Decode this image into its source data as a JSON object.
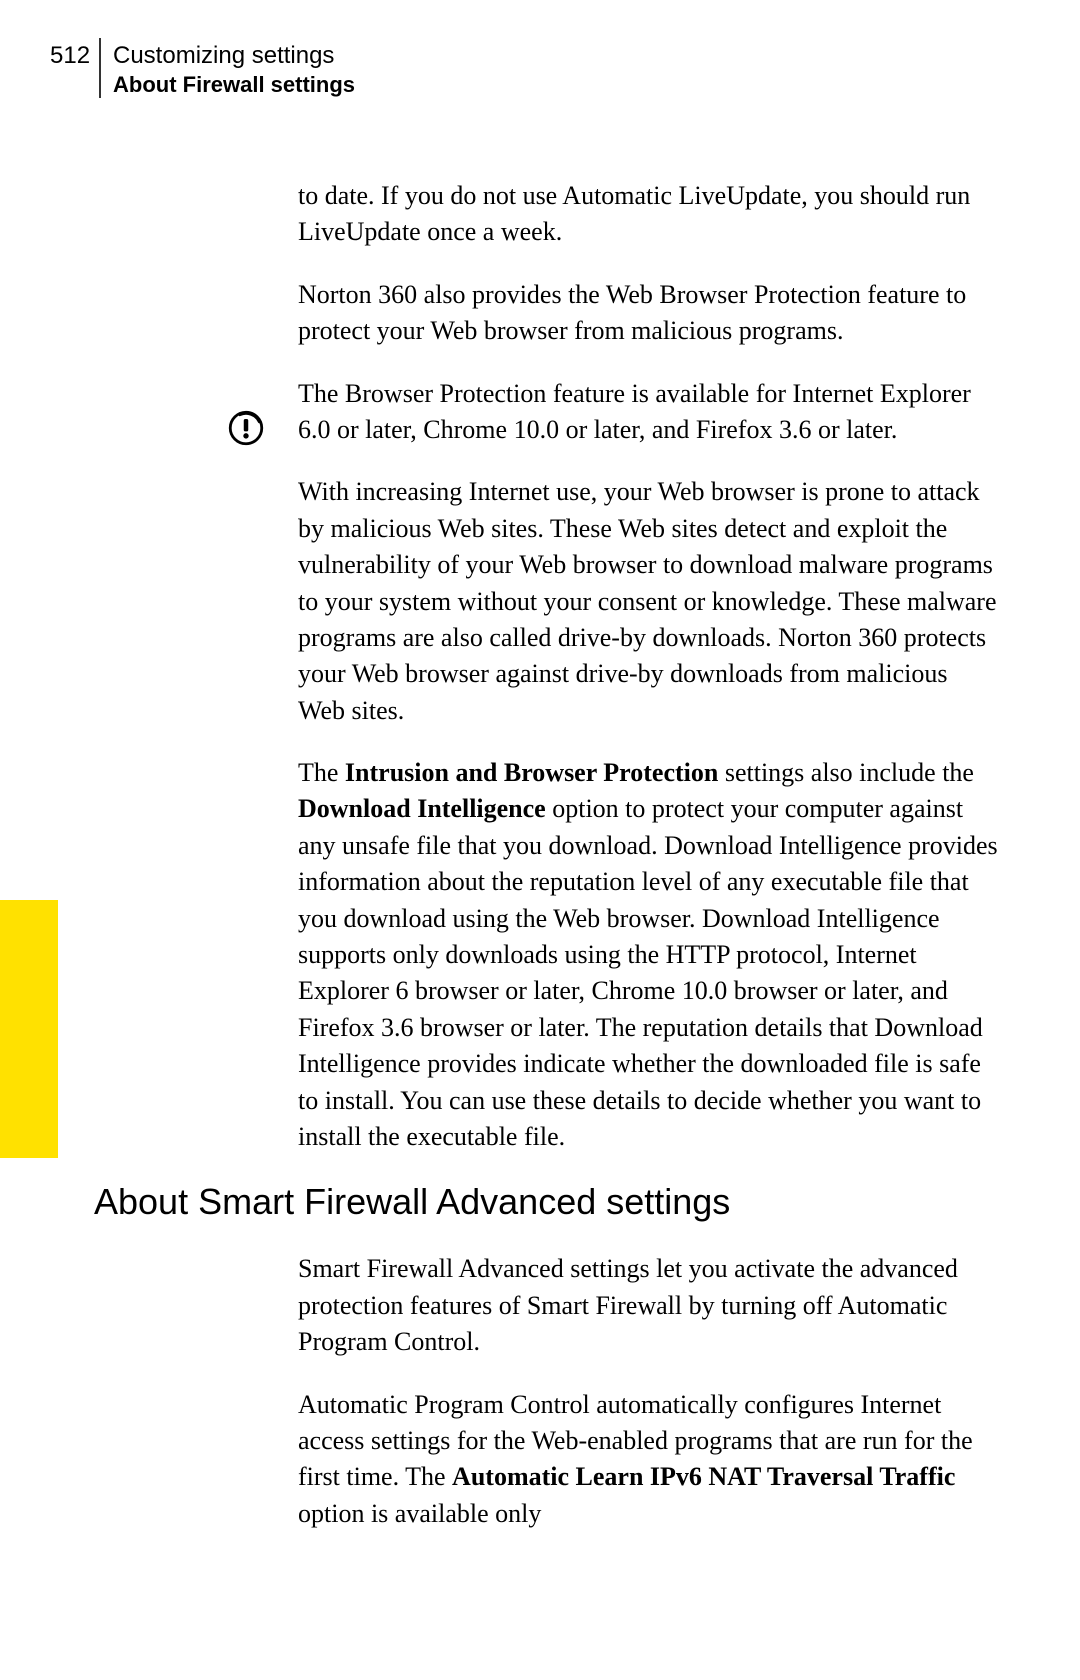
{
  "header": {
    "page_number": "512",
    "chapter": "Customizing settings",
    "section": "About Firewall settings"
  },
  "paragraphs": {
    "p1": "to date. If you do not use Automatic LiveUpdate, you should run LiveUpdate once a week.",
    "p2": "Norton 360 also provides the Web Browser Protection feature to protect your Web browser from malicious programs.",
    "p3": "The Browser Protection feature is available for Internet Explorer 6.0 or later, Chrome 10.0 or later, and Firefox 3.6 or later.",
    "p4": "With increasing Internet use, your Web browser is prone to attack by malicious Web sites. These Web sites detect and exploit the vulnerability of your Web browser to download malware programs to your system without your consent or knowledge. These malware programs are also called drive-by downloads. Norton 360 protects your Web browser against drive-by downloads from malicious Web sites.",
    "p5_pre": "The ",
    "p5_b1": "Intrusion and Browser Protection",
    "p5_mid": " settings also include the ",
    "p5_b2": "Download Intelligence",
    "p5_post": " option to protect your computer against any unsafe file that you download. Download Intelligence provides information about the reputation level of any executable file that you download using the Web browser. Download Intelligence supports only downloads using the HTTP protocol, Internet Explorer 6 browser or later, Chrome 10.0 browser or later, and Firefox 3.6 browser or later. The reputation details that Download Intelligence provides indicate whether the downloaded file is safe to install. You can use these details to decide whether you want to install the executable file.",
    "heading": "About Smart Firewall Advanced settings",
    "p6": "Smart Firewall Advanced settings let you activate the advanced protection features of Smart Firewall by turning off Automatic Program Control.",
    "p7_pre": "Automatic Program Control automatically configures Internet access settings for the Web-enabled programs that are run for the first time. The ",
    "p7_b1": "Automatic Learn IPv6 NAT Traversal Traffic",
    "p7_post": " option is available only"
  }
}
